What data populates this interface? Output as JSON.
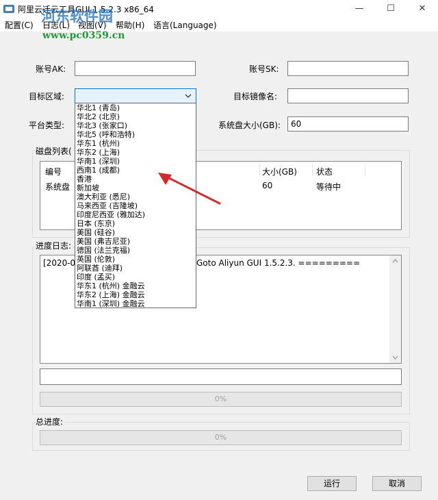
{
  "window": {
    "title": "阿里云迁云工具GUI 1.5.2.3 x86_64",
    "minimize": "—",
    "maximize": "☐",
    "close": "✕"
  },
  "menu": [
    "配置(C)",
    "日志(L)",
    "视图(V)",
    "帮助(H)",
    "语言(Language)"
  ],
  "watermark": {
    "text": "河东软件园",
    "url": "www.pc0359.cn"
  },
  "form": {
    "ak_label": "账号AK:",
    "ak_value": "",
    "sk_label": "账号SK:",
    "sk_value": "",
    "region_label": "目标区域:",
    "region_value": "",
    "image_label": "目标镜像名:",
    "image_value": "",
    "platform_label": "平台类型:",
    "disk_size_label": "系统盘大小(GB):",
    "disk_size_value": "60"
  },
  "disk_list": {
    "label": "磁盘列表(",
    "headers": [
      "编号",
      "大小(GB)",
      "状态"
    ],
    "rows": [
      [
        "系统盘",
        "60",
        "等待中"
      ]
    ]
  },
  "log": {
    "label": "进度日志:",
    "line_start": "[2020-04",
    "line_end": "Goto Aliyun GUI 1.5.2.3. ========="
  },
  "progress_bar": {
    "value": 0,
    "text": "0%"
  },
  "total": {
    "label": "总进度:",
    "value": 0,
    "text": "0%"
  },
  "buttons": {
    "run": "运行",
    "cancel": "取消"
  },
  "dropdown_items": [
    "华北1 (青岛)",
    "华北2 (北京)",
    "华北3 (张家口)",
    "华北5 (呼和浩特)",
    "华东1 (杭州)",
    "华东2 (上海)",
    "华南1 (深圳)",
    "西南1 (成都)",
    "香港",
    "新加坡",
    "澳大利亚 (悉尼)",
    "马来西亚 (吉隆坡)",
    "印度尼西亚 (雅加达)",
    "日本 (东京)",
    "美国 (硅谷)",
    "美国 (弗吉尼亚)",
    "德国 (法兰克福)",
    "英国 (伦敦)",
    "阿联酋 (迪拜)",
    "印度 (孟买)",
    "华东1 (杭州) 金融云",
    "华东2 (上海) 金融云",
    "华南1 (深圳) 金融云"
  ],
  "colors": {
    "accent": "#0078d7",
    "arrow": "#d42a2a",
    "watermark": "#1d6ec1",
    "watermark_url": "#1f9b38"
  }
}
